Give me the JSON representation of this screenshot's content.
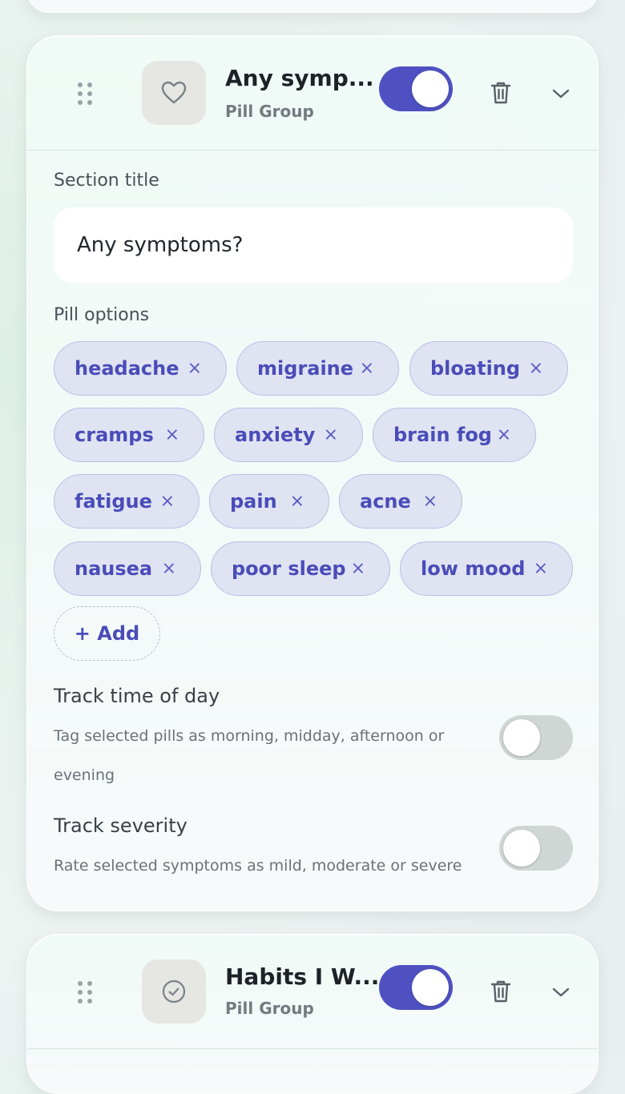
{
  "main_card": {
    "title": "Any symp...",
    "subtitle": "Pill Group",
    "icon": "heart-icon",
    "enabled": true,
    "section_title_label": "Section title",
    "section_title_value": "Any symptoms?",
    "pill_options_label": "Pill options",
    "pills": [
      "headache",
      "migraine",
      "bloating",
      "cramps",
      "anxiety",
      "brain fog",
      "fatigue",
      "pain",
      "acne",
      "nausea",
      "poor sleep",
      "low mood"
    ],
    "remove_glyph": "×",
    "add_label": "+ Add",
    "options": [
      {
        "title": "Track time of day",
        "description": "Tag selected pills as morning, midday, afternoon or evening",
        "enabled": false
      },
      {
        "title": "Track severity",
        "description": "Rate selected symptoms as mild, moderate or severe",
        "enabled": false
      }
    ]
  },
  "second_card": {
    "title": "Habits I W...",
    "subtitle": "Pill Group",
    "icon": "check-circle-icon",
    "enabled": true
  },
  "colors": {
    "accent": "#4f51c2",
    "pill_bg": "#dfe3f2",
    "pill_text": "#4a4cb8"
  }
}
